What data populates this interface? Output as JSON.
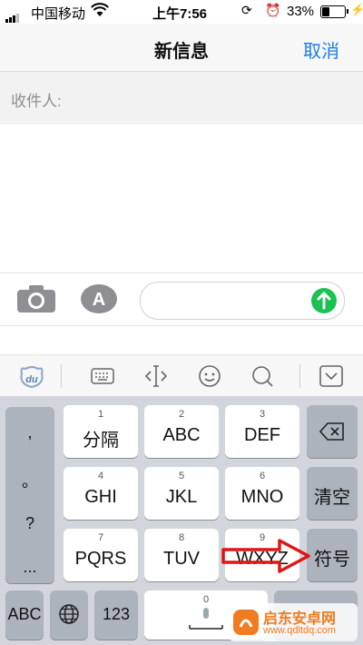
{
  "status_bar": {
    "carrier": "中国移动",
    "time": "上午7:56",
    "battery_percent": "33%",
    "battery_level": 0.33,
    "icons": [
      "signal-icon",
      "wifi-icon",
      "orientation-lock-icon",
      "alarm-icon",
      "battery-icon",
      "charging-icon"
    ]
  },
  "nav": {
    "title": "新信息",
    "cancel_label": "取消"
  },
  "recipient": {
    "label": "收件人:"
  },
  "compose": {
    "icons": [
      "camera-icon",
      "app-store-icon",
      "send-icon"
    ],
    "send_color": "#1bc152"
  },
  "toolbar": {
    "icons": [
      "du-logo-icon",
      "keyboard-icon",
      "cursor-move-icon",
      "emoji-icon",
      "search-icon",
      "collapse-keyboard-icon"
    ]
  },
  "keyboard": {
    "punctuation": [
      ",",
      "。",
      "?",
      "..."
    ],
    "keys": [
      {
        "num": "1",
        "label": "分隔"
      },
      {
        "num": "2",
        "label": "ABC"
      },
      {
        "num": "3",
        "label": "DEF"
      },
      {
        "num": "4",
        "label": "GHI"
      },
      {
        "num": "5",
        "label": "JKL"
      },
      {
        "num": "6",
        "label": "MNO"
      },
      {
        "num": "7",
        "label": "PQRS"
      },
      {
        "num": "8",
        "label": "TUV"
      },
      {
        "num": "9",
        "label": "WXYZ"
      }
    ],
    "side_keys": {
      "clear_label": "清空",
      "symbol_label": "符号"
    },
    "bottom_row": {
      "abc_label": "ABC",
      "num123_label": "123",
      "space_num": "0"
    }
  },
  "watermark": {
    "text": "启东安卓网",
    "url": "www.qdltdq.com"
  }
}
